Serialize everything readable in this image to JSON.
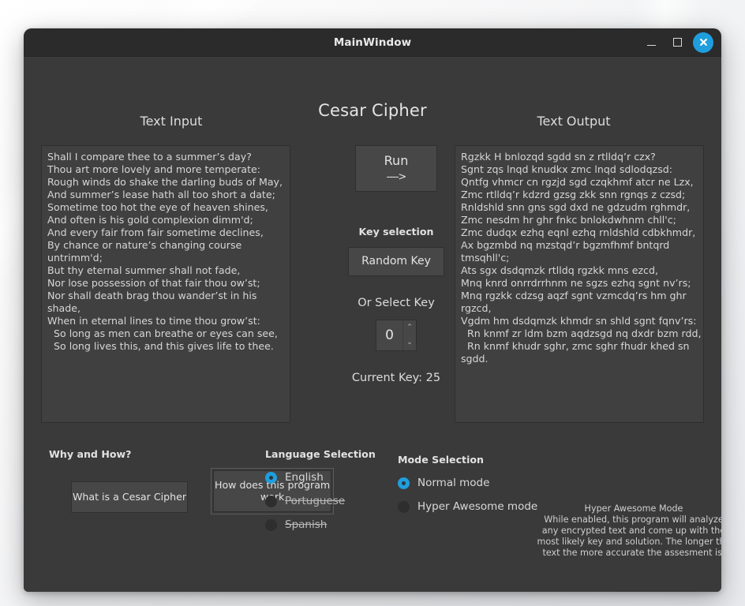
{
  "window": {
    "title": "MainWindow",
    "controls": {
      "minimize": "minimize-icon",
      "maximize": "maximize-icon",
      "close": "close-icon"
    }
  },
  "app": {
    "title": "Cesar Cipher"
  },
  "panels": {
    "input_label": "Text Input",
    "output_label": "Text Output"
  },
  "input_text": {
    "lines": [
      "Shall I compare thee to a summer’s day?",
      "Thou art more lovely and more temperate:",
      "Rough winds do shake the darling buds of May,",
      "And summer’s lease hath all too short a date;",
      "Sometime too hot the eye of heaven shines,",
      "And often is his gold complexion dimm'd;",
      "And every fair from fair sometime declines,",
      "By chance or nature’s changing course untrimm'd;",
      "But thy eternal summer shall not fade,",
      "Nor lose possession of that fair thou ow’st;",
      "Nor shall death brag thou wander’st in his shade,",
      "When in eternal lines to time thou grow’st:",
      "  So long as men can breathe or eyes can see,",
      "  So long lives this, and this gives life to thee."
    ]
  },
  "output_text": {
    "lines": [
      "Rgzkk H bnlozqd sgdd sn z rtlldq’r czx?",
      "Sgnt zqs lnqd knudkx zmc lnqd sdlodqzsd:",
      "Qntfg vhmcr cn rgzjd sgd czqkhmf atcr ne Lzx,",
      "Zmc rtlldq’r kdzrd gzsg zkk snn rgnqs z czsd;",
      "Rnldshld snn gns sgd dxd ne gdzudm rghmdr,",
      "Zmc nesdm hr ghr fnkc bnlokdwhnm chll'c;",
      "Zmc dudqx ezhq eqnl ezhq rnldshld cdbkhmdr,",
      "Ax bgzmbd nq mzstqd’r bgzmfhmf bntqrd tmsqhll'c;",
      "Ats sgx dsdqmzk rtlldq rgzkk mns ezcd,",
      "Mnq knrd onrrdrrhnm ne sgzs ezhq sgnt nv’rs;",
      "Mnq rgzkk cdzsg aqzf sgnt vzmcdq’rs hm ghr rgzcd,",
      "Vgdm hm dsdqmzk khmdr sn shld sgnt fqnv’rs:",
      "  Rn knmf zr ldm bzm aqdzsgd nq dxdr bzm rdd,",
      "  Rn knmf khudr sghr, zmc sghr fhudr khed sn sgdd."
    ]
  },
  "center": {
    "run_label": "Run",
    "run_arrow": "---->",
    "key_selection_label": "Key selection",
    "random_key_label": "Random Key",
    "or_select_key_label": "Or Select Key",
    "key_value": "0",
    "spin_up": "⌃",
    "spin_down": "⌄",
    "current_key_label": "Current Key: 25"
  },
  "why_and_how": {
    "title": "Why and How?",
    "button_1": "What is a Cesar Cipher",
    "button_2": "How does this program work"
  },
  "language_selection": {
    "title": "Language Selection",
    "options": [
      {
        "label": "English",
        "selected": true,
        "disabled": false
      },
      {
        "label": "Portuguese",
        "selected": false,
        "disabled": true
      },
      {
        "label": "Spanish",
        "selected": false,
        "disabled": true
      }
    ]
  },
  "mode_selection": {
    "title": "Mode Selection",
    "options": [
      {
        "label": "Normal mode",
        "selected": true,
        "disabled": false
      },
      {
        "label": "Hyper Awesome mode",
        "selected": false,
        "disabled": false
      }
    ]
  },
  "hyper_description": {
    "heading": "Hyper Awesome Mode",
    "body": "While enabled, this program will analyze any encrypted text and come up with the most likely key and solution. The longer the text the more accurate the assesment is."
  },
  "colors": {
    "accent": "#1f9ede",
    "window_bg": "#3a3a3a",
    "titlebar_bg": "#2b2b2b",
    "field_bg": "#404040",
    "text": "#d8d8d8"
  }
}
